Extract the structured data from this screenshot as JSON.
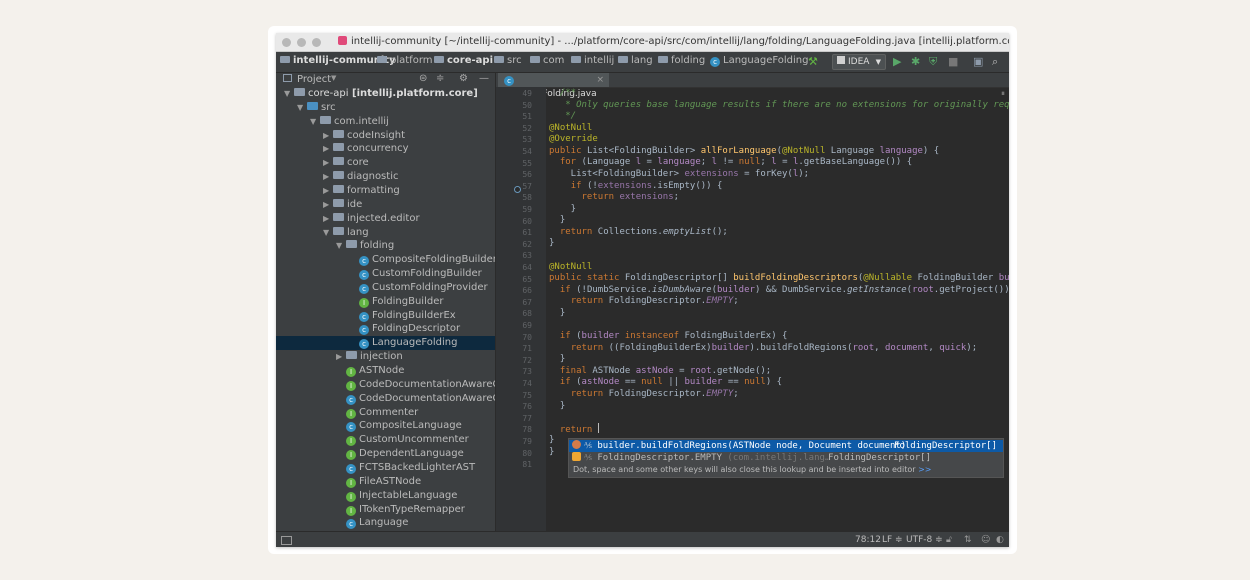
{
  "window": {
    "title": "intellij-community [~/intellij-community] - .../platform/core-api/src/com/intellij/lang/folding/LanguageFolding.java [intellij.platform.core]"
  },
  "navbar": {
    "crumbs": [
      "intellij-community",
      "platform",
      "core-api",
      "src",
      "com",
      "intellij",
      "lang",
      "folding",
      "LanguageFolding"
    ],
    "run_config": "IDEA"
  },
  "project": {
    "label": "Project",
    "tree": [
      {
        "label": "core-api",
        "module": "[intellij.platform.core]",
        "type": "module",
        "level": 0,
        "expanded": true
      },
      {
        "label": "src",
        "type": "folder",
        "level": 1,
        "expanded": true
      },
      {
        "label": "com.intellij",
        "type": "folder",
        "level": 2,
        "expanded": true
      },
      {
        "label": "codeInsight",
        "type": "folder",
        "level": 3,
        "expanded": false
      },
      {
        "label": "concurrency",
        "type": "folder",
        "level": 3,
        "expanded": false
      },
      {
        "label": "core",
        "type": "folder",
        "level": 3,
        "expanded": false
      },
      {
        "label": "diagnostic",
        "type": "folder",
        "level": 3,
        "expanded": false
      },
      {
        "label": "formatting",
        "type": "folder",
        "level": 3,
        "expanded": false
      },
      {
        "label": "ide",
        "type": "folder",
        "level": 3,
        "expanded": false
      },
      {
        "label": "injected.editor",
        "type": "folder",
        "level": 3,
        "expanded": false
      },
      {
        "label": "lang",
        "type": "folder",
        "level": 3,
        "expanded": true
      },
      {
        "label": "folding",
        "type": "folder",
        "level": 4,
        "expanded": true
      },
      {
        "label": "CompositeFoldingBuilder",
        "type": "class",
        "level": 5
      },
      {
        "label": "CustomFoldingBuilder",
        "type": "class",
        "level": 5
      },
      {
        "label": "CustomFoldingProvider",
        "type": "class",
        "level": 5
      },
      {
        "label": "FoldingBuilder",
        "type": "interface",
        "level": 5
      },
      {
        "label": "FoldingBuilderEx",
        "type": "class",
        "level": 5
      },
      {
        "label": "FoldingDescriptor",
        "type": "class",
        "level": 5
      },
      {
        "label": "LanguageFolding",
        "type": "class",
        "level": 5,
        "selected": true
      },
      {
        "label": "injection",
        "type": "folder",
        "level": 4,
        "expanded": false
      },
      {
        "label": "ASTNode",
        "type": "interface",
        "level": 4
      },
      {
        "label": "CodeDocumentationAwareCo",
        "type": "interface",
        "level": 4
      },
      {
        "label": "CodeDocumentationAwareCo",
        "type": "class",
        "level": 4
      },
      {
        "label": "Commenter",
        "type": "interface",
        "level": 4
      },
      {
        "label": "CompositeLanguage",
        "type": "class",
        "level": 4
      },
      {
        "label": "CustomUncommenter",
        "type": "interface",
        "level": 4
      },
      {
        "label": "DependentLanguage",
        "type": "interface",
        "level": 4
      },
      {
        "label": "FCTSBackedLighterAST",
        "type": "class",
        "level": 4
      },
      {
        "label": "FileASTNode",
        "type": "interface",
        "level": 4
      },
      {
        "label": "InjectableLanguage",
        "type": "interface",
        "level": 4
      },
      {
        "label": "ITokenTypeRemapper",
        "type": "interface",
        "level": 4
      },
      {
        "label": "Language",
        "type": "class",
        "level": 4
      }
    ]
  },
  "editor": {
    "tab_label": "LanguageFolding.java",
    "line_numbers": [
      "49",
      "50",
      "51",
      "52",
      "53",
      "54",
      "55",
      "56",
      "57",
      "58",
      "59",
      "60",
      "61",
      "62",
      "63",
      "64",
      "65",
      "66",
      "67",
      "68",
      "69",
      "70",
      "71",
      "72",
      "73",
      "74",
      "75",
      "76",
      "77",
      "78",
      "79",
      "80",
      "81"
    ]
  },
  "completion": {
    "items": [
      {
        "text": "builder.buildFoldRegions(ASTNode node, Document document)",
        "type": "FoldingDescriptor[]",
        "selected": true
      },
      {
        "text": "FoldingDescriptor.EMPTY",
        "context": "(com.intellij.lang…",
        "type": "FoldingDescriptor[]",
        "selected": false
      }
    ],
    "hint": "Dot, space and some other keys will also close this lookup and be inserted into editor",
    "hint_link": ">>"
  },
  "status": {
    "position": "78:12",
    "line_sep": "LF ≑",
    "encoding": "UTF-8 ≑"
  }
}
